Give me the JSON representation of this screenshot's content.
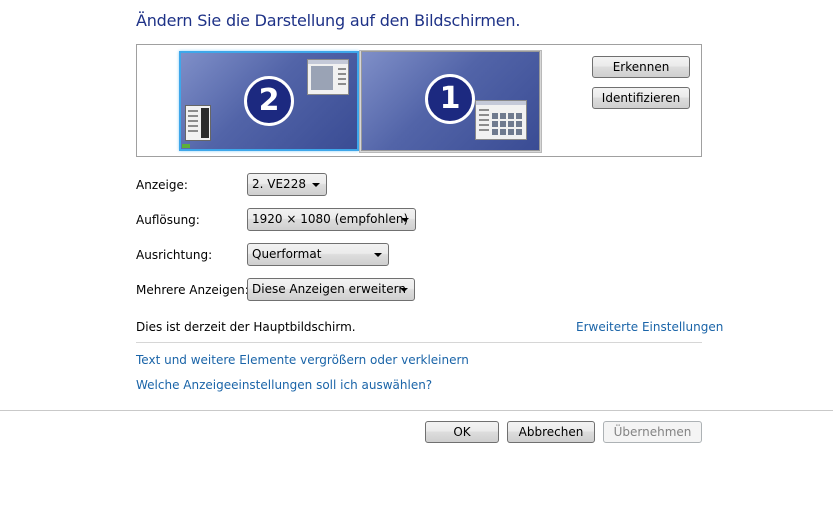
{
  "title": "Ändern Sie die Darstellung auf den Bildschirmen.",
  "monitors": {
    "primary_number": "2",
    "secondary_number": "1"
  },
  "buttons": {
    "detect": "Erkennen",
    "identify": "Identifizieren",
    "ok": "OK",
    "cancel": "Abbrechen",
    "apply": "Übernehmen"
  },
  "fields": {
    "display_label": "Anzeige:",
    "display_value": "2. VE228",
    "resolution_label": "Auflösung:",
    "resolution_value": "1920 × 1080 (empfohlen)",
    "orientation_label": "Ausrichtung:",
    "orientation_value": "Querformat",
    "multiple_label": "Mehrere Anzeigen:",
    "multiple_value": "Diese Anzeigen erweitern"
  },
  "status_text": "Dies ist derzeit der Hauptbildschirm.",
  "links": {
    "advanced": "Erweiterte Einstellungen",
    "text_size": "Text und weitere Elemente vergrößern oder verkleinern",
    "which_settings": "Welche Anzeigeeinstellungen soll ich auswählen?"
  },
  "colors": {
    "title": "#1e3287",
    "link": "#1a64a8",
    "selection_border": "#3ea7ea",
    "monitor_number_bg": "#1c2980"
  }
}
